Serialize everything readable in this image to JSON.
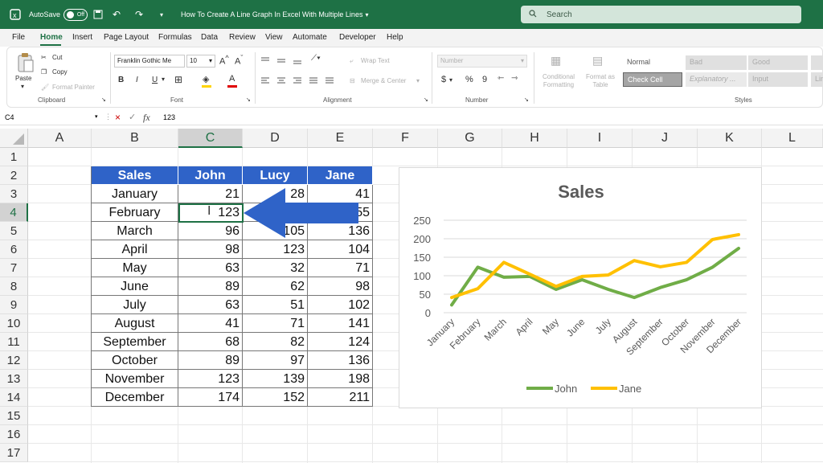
{
  "titlebar": {
    "autosave_label": "AutoSave",
    "autosave_state": "Off",
    "doc_title": "How To Create A Line Graph In Excel With Multiple Lines",
    "search_placeholder": "Search"
  },
  "menu": [
    "File",
    "Home",
    "Insert",
    "Page Layout",
    "Formulas",
    "Data",
    "Review",
    "View",
    "Automate",
    "Developer",
    "Help"
  ],
  "ribbon": {
    "clipboard": {
      "paste": "Paste",
      "cut": "Cut",
      "copy": "Copy",
      "format_painter": "Format Painter",
      "label": "Clipboard"
    },
    "font": {
      "name": "Franklin Gothic Me",
      "size": "10",
      "bold": "B",
      "italic": "I",
      "underline": "U",
      "label": "Font"
    },
    "alignment": {
      "wrap": "Wrap Text",
      "merge": "Merge & Center",
      "label": "Alignment"
    },
    "number": {
      "format": "Number",
      "currency": "$",
      "percent": "%",
      "comma": "9",
      "label": "Number"
    },
    "styles": {
      "conditional": "Conditional Formatting",
      "format_table": "Format as Table",
      "normal": "Normal",
      "bad": "Bad",
      "good": "Good",
      "check_cell": "Check Cell",
      "explanatory": "Explanatory ...",
      "input": "Input",
      "linked": "Lin",
      "label": "Styles"
    }
  },
  "formula_bar": {
    "cell_ref": "C4",
    "value": "123"
  },
  "columns": [
    "A",
    "B",
    "C",
    "D",
    "E",
    "F",
    "G",
    "H",
    "I",
    "J",
    "K",
    "L"
  ],
  "rows": [
    "1",
    "2",
    "3",
    "4",
    "5",
    "6",
    "7",
    "8",
    "9",
    "10",
    "11",
    "12",
    "13",
    "14",
    "15",
    "16",
    "17"
  ],
  "table": {
    "headers": [
      "Sales",
      "John",
      "Lucy",
      "Jane"
    ],
    "rows": [
      [
        "January",
        "21",
        "28",
        "41"
      ],
      [
        "February",
        "123",
        "",
        "55"
      ],
      [
        "March",
        "96",
        "105",
        "136"
      ],
      [
        "April",
        "98",
        "123",
        "104"
      ],
      [
        "May",
        "63",
        "32",
        "71"
      ],
      [
        "June",
        "89",
        "62",
        "98"
      ],
      [
        "July",
        "63",
        "51",
        "102"
      ],
      [
        "August",
        "41",
        "71",
        "141"
      ],
      [
        "September",
        "68",
        "82",
        "124"
      ],
      [
        "October",
        "89",
        "97",
        "136"
      ],
      [
        "November",
        "123",
        "139",
        "198"
      ],
      [
        "December",
        "174",
        "152",
        "211"
      ]
    ]
  },
  "arrow_color": "#2f63c8",
  "chart_data": {
    "type": "line",
    "title": "Sales",
    "categories": [
      "January",
      "February",
      "March",
      "April",
      "May",
      "June",
      "July",
      "August",
      "September",
      "October",
      "November",
      "December"
    ],
    "series": [
      {
        "name": "John",
        "color": "#70ad47",
        "values": [
          21,
          123,
          96,
          98,
          63,
          89,
          63,
          41,
          68,
          89,
          123,
          174
        ]
      },
      {
        "name": "Jane",
        "color": "#ffc000",
        "values": [
          41,
          65,
          136,
          104,
          71,
          98,
          102,
          141,
          124,
          136,
          198,
          211
        ]
      }
    ],
    "yticks": [
      "250",
      "200",
      "150",
      "100",
      "50",
      "0"
    ],
    "ylim": [
      0,
      250
    ],
    "grid": true,
    "legend": "bottom"
  }
}
